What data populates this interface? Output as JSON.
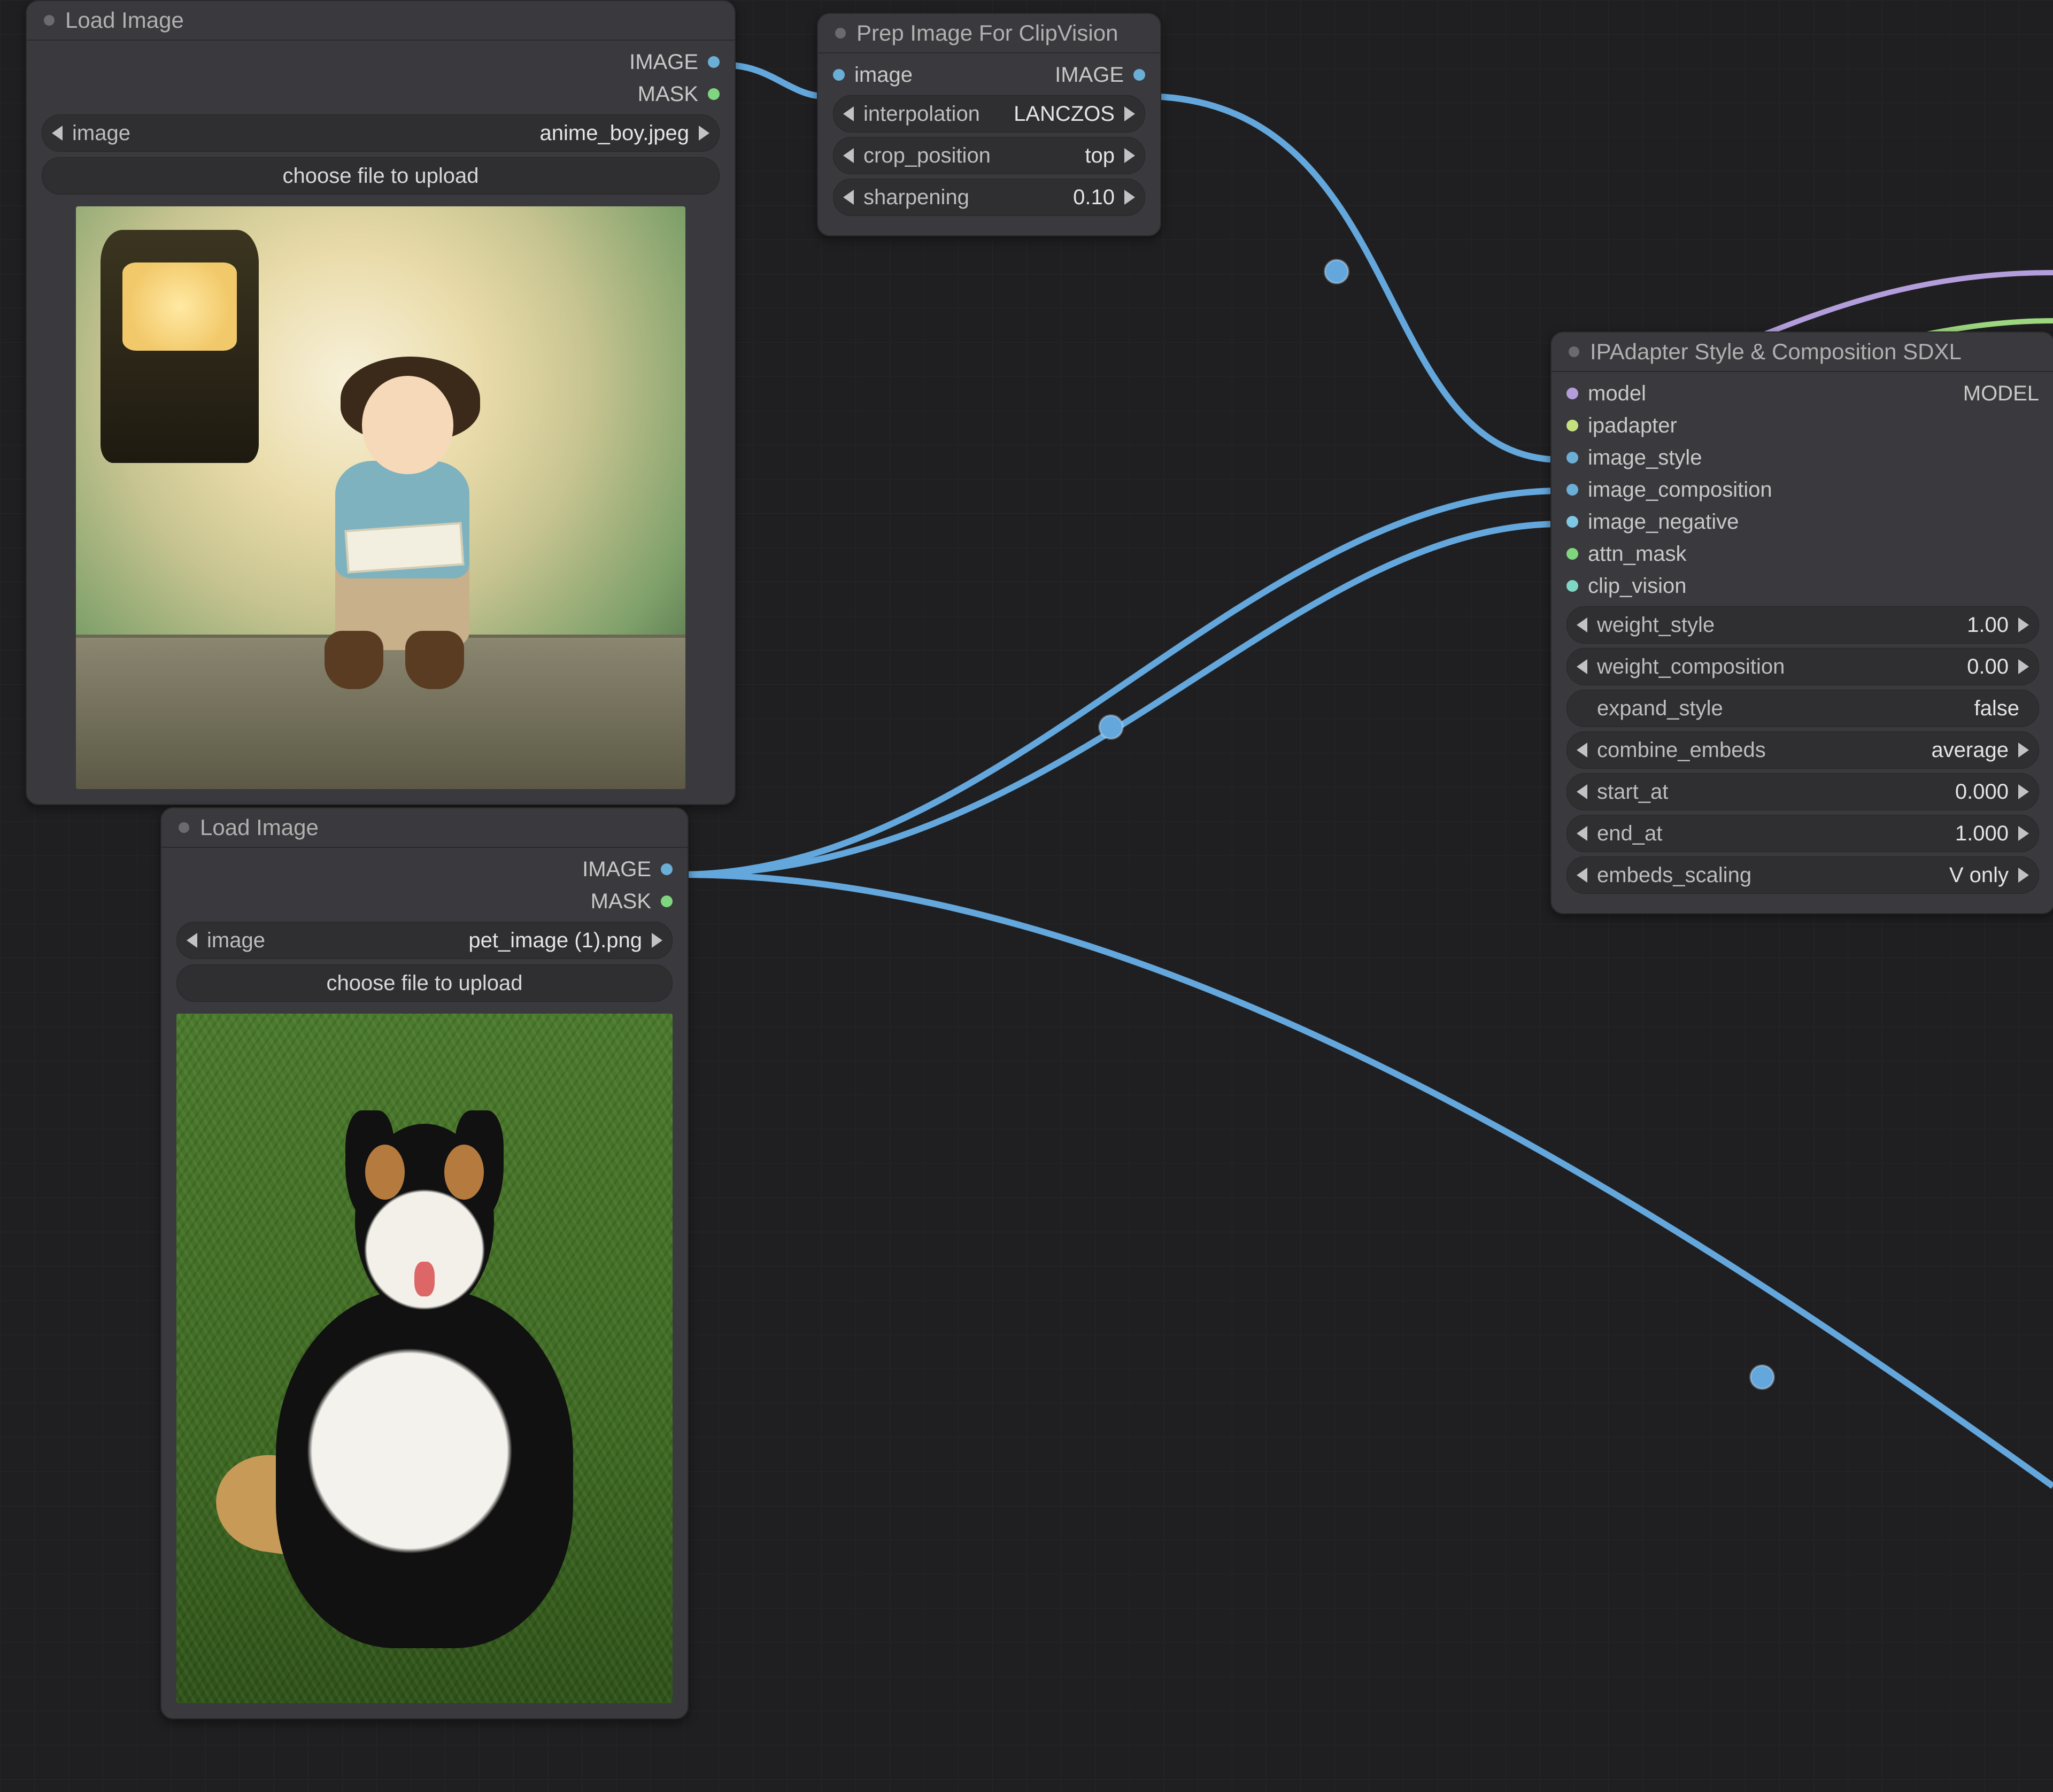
{
  "nodes": {
    "load1": {
      "title": "Load Image",
      "out_image": "IMAGE",
      "out_mask": "MASK",
      "image_widget": {
        "label": "image",
        "value": "anime_boy.jpeg"
      },
      "upload_btn": "choose file to upload"
    },
    "load2": {
      "title": "Load Image",
      "out_image": "IMAGE",
      "out_mask": "MASK",
      "image_widget": {
        "label": "image",
        "value": "pet_image (1).png"
      },
      "upload_btn": "choose file to upload"
    },
    "prep": {
      "title": "Prep Image For ClipVision",
      "in_image": "image",
      "out_image": "IMAGE",
      "interp": {
        "label": "interpolation",
        "value": "LANCZOS"
      },
      "crop": {
        "label": "crop_position",
        "value": "top"
      },
      "sharpen": {
        "label": "sharpening",
        "value": "0.10"
      }
    },
    "ipa": {
      "title": "IPAdapter Style & Composition SDXL",
      "in_model": "model",
      "in_ipadapter": "ipadapter",
      "in_image_style": "image_style",
      "in_image_composition": "image_composition",
      "in_image_negative": "image_negative",
      "in_attn_mask": "attn_mask",
      "in_clip_vision": "clip_vision",
      "out_model": "MODEL",
      "w_style": {
        "label": "weight_style",
        "value": "1.00"
      },
      "w_comp": {
        "label": "weight_composition",
        "value": "0.00"
      },
      "expand": {
        "label": "expand_style",
        "value": "false"
      },
      "combine": {
        "label": "combine_embeds",
        "value": "average"
      },
      "start_at": {
        "label": "start_at",
        "value": "0.000"
      },
      "end_at": {
        "label": "end_at",
        "value": "1.000"
      },
      "scaling": {
        "label": "embeds_scaling",
        "value": "V only"
      }
    }
  }
}
